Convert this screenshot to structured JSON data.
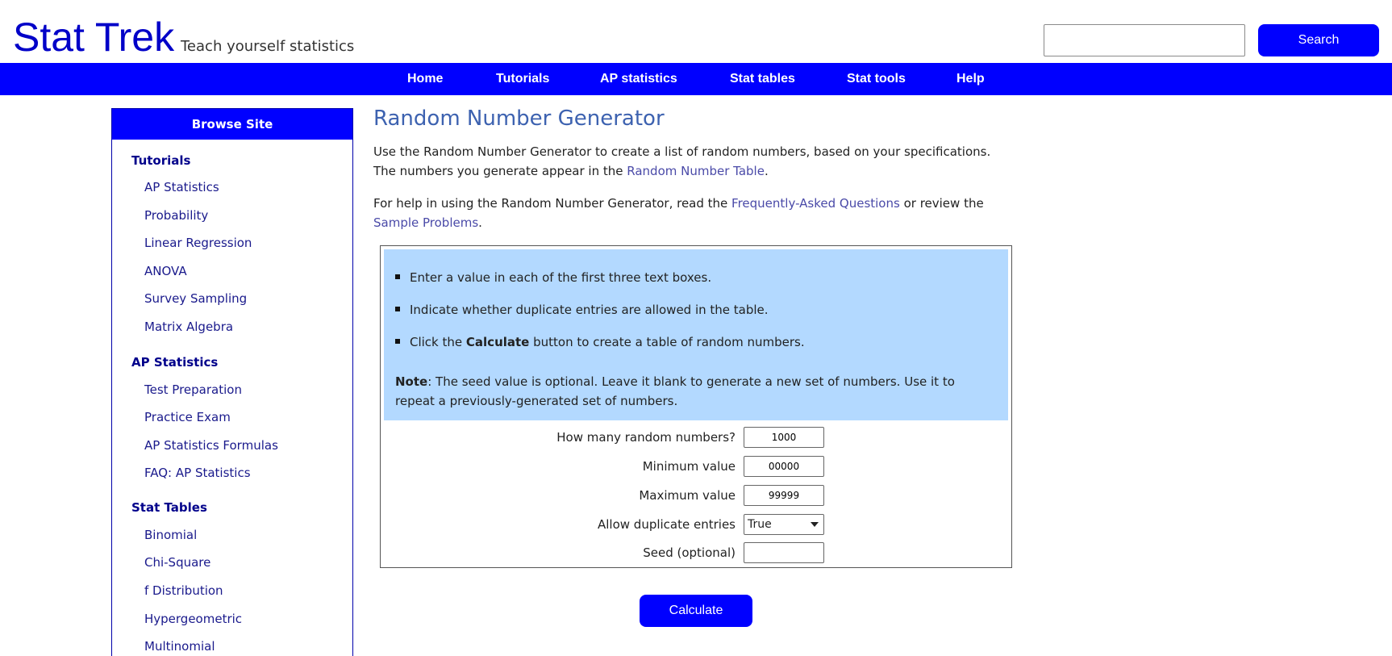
{
  "header": {
    "brand": "Stat Trek",
    "tagline": "Teach yourself statistics",
    "search_value": "",
    "search_button": "Search"
  },
  "nav": [
    "Home",
    "Tutorials",
    "AP statistics",
    "Stat tables",
    "Stat tools",
    "Help"
  ],
  "sidebar": {
    "title": "Browse Site",
    "sections": [
      {
        "heading": "Tutorials",
        "items": [
          "AP Statistics",
          "Probability",
          "Linear Regression",
          "ANOVA",
          "Survey Sampling",
          "Matrix Algebra"
        ]
      },
      {
        "heading": "AP Statistics",
        "items": [
          "Test Preparation",
          "Practice Exam",
          "AP Statistics Formulas",
          "FAQ: AP Statistics"
        ]
      },
      {
        "heading": "Stat Tables",
        "items": [
          "Binomial",
          "Chi-Square",
          "f Distribution",
          "Hypergeometric",
          "Multinomial"
        ]
      }
    ]
  },
  "main": {
    "title": "Random Number Generator",
    "intro_1": "Use the Random Number Generator to create a list of random numbers, based on your specifications. The numbers you generate appear in the ",
    "intro_link": "Random Number Table",
    "intro_end": ".",
    "help_1": "For help in using the Random Number Generator, read the ",
    "help_link_faq": "Frequently-Asked Questions",
    "help_mid": " or review the ",
    "help_link_samples": "Sample Problems",
    "help_end": ".",
    "instructions": {
      "bullet_1": "Enter a value in each of the first three text boxes.",
      "bullet_2": "Indicate whether duplicate entries are allowed in the table.",
      "bullet_3_pre": "Click the ",
      "bullet_3_bold": "Calculate",
      "bullet_3_post": " button to create a table of random numbers.",
      "note_bold": "Note",
      "note_text": ": The seed value is optional. Leave it blank to generate a new set of numbers. Use it to repeat a previously-generated set of numbers."
    },
    "form": {
      "count_label": "How many random numbers?",
      "count_value": "1000",
      "min_label": "Minimum value",
      "min_value": "00000",
      "max_label": "Maximum value",
      "max_value": "99999",
      "dup_label": "Allow duplicate entries",
      "dup_value": "True",
      "seed_label": "Seed (optional)",
      "seed_value": ""
    },
    "calculate_button": "Calculate"
  }
}
